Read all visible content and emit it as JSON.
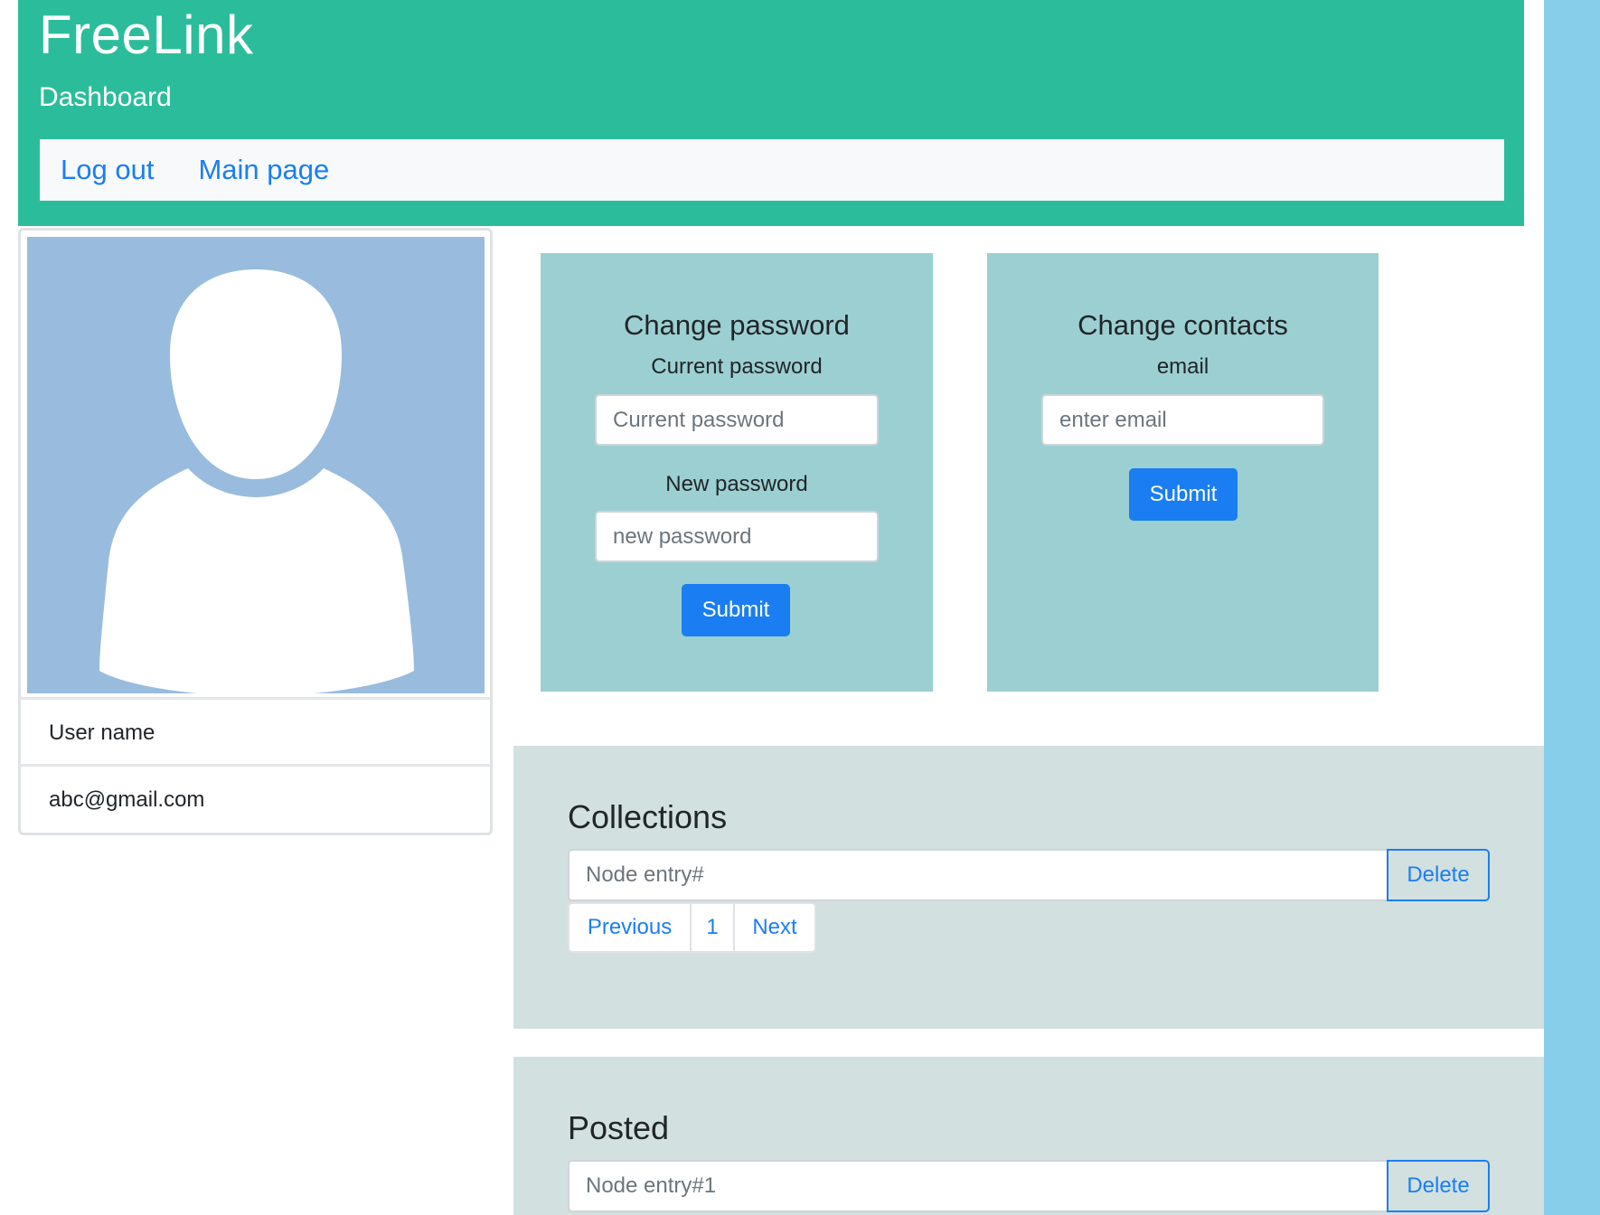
{
  "header": {
    "brand": "FreeLink",
    "subtitle": "Dashboard",
    "nav": [
      {
        "label": "Log out"
      },
      {
        "label": "Main page"
      }
    ]
  },
  "profile": {
    "avatar_icon": "user-silhouette-icon",
    "username": "User name",
    "email": "abc@gmail.com"
  },
  "change_password": {
    "title": "Change password",
    "current_label": "Current password",
    "current_placeholder": "Current password",
    "new_label": "New password",
    "new_placeholder": "new password",
    "submit_label": "Submit"
  },
  "change_contacts": {
    "title": "Change contacts",
    "email_label": "email",
    "email_placeholder": "enter email",
    "submit_label": "Submit"
  },
  "collections": {
    "title": "Collections",
    "entry_placeholder": "Node entry#",
    "delete_label": "Delete",
    "pagination": {
      "previous": "Previous",
      "page": "1",
      "next": "Next"
    }
  },
  "posted": {
    "title": "Posted",
    "entry_placeholder": "Node entry#1",
    "delete_label": "Delete"
  },
  "colors": {
    "header_bg": "#2bbd9b",
    "card_bg": "#9ccfd1",
    "section_bg": "#d2e0e0",
    "primary": "#1a7ef2",
    "side_strip": "#87ceeb",
    "avatar_bg": "#99bcde"
  }
}
